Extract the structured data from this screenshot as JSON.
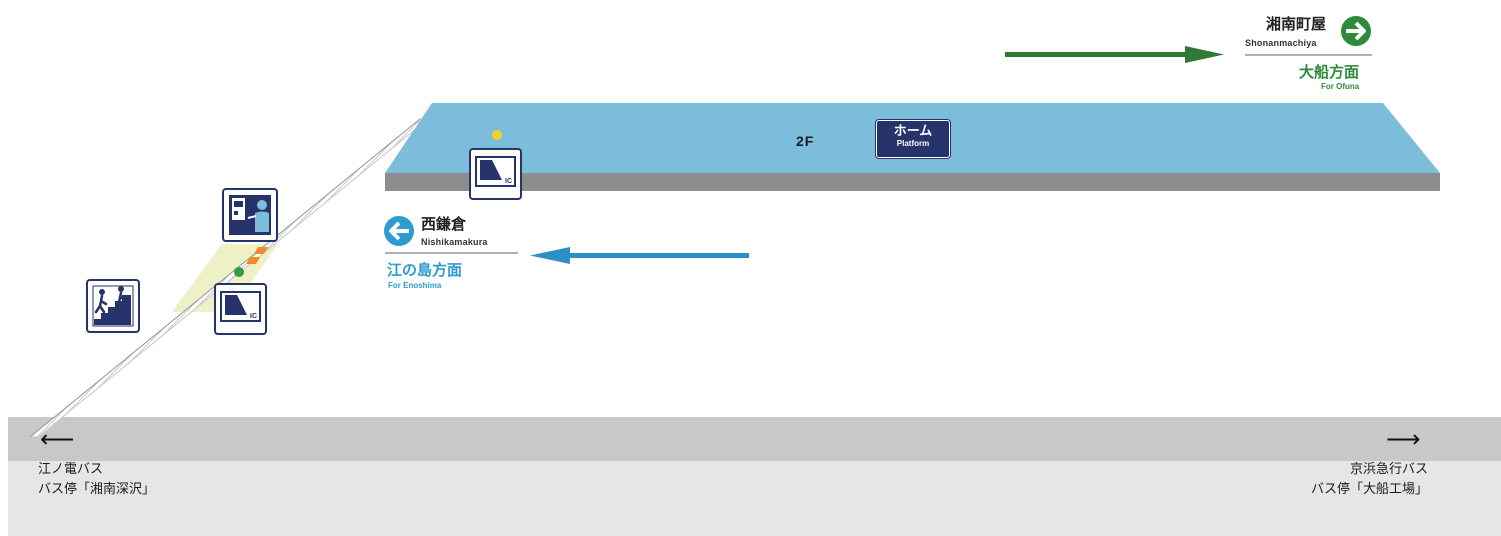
{
  "directions": {
    "right": {
      "station_name": "湘南町屋",
      "station_roman": "Shonanmachiya",
      "direction_jp": "大船方面",
      "direction_en": "For Ofuna",
      "color": "#2f8a3a"
    },
    "left": {
      "station_name": "西鎌倉",
      "station_roman": "Nishikamakura",
      "direction_jp": "江の島方面",
      "direction_en": "For Enoshima",
      "color": "#2e9ad0"
    }
  },
  "platform": {
    "floor": "2F",
    "label_jp": "ホーム",
    "label_en": "Platform",
    "color": "#7dbddc"
  },
  "bus_stops": {
    "left": {
      "line1": "江ノ電バス",
      "line2": "バス停「湘南深沢」",
      "arrow": "⟵"
    },
    "right": {
      "line1": "京浜急行バス",
      "line2": "バス停「大船工場」",
      "arrow": "⟶"
    }
  },
  "icons": {
    "ic_gate_platform": "ic-card-reader-icon",
    "ic_gate_ground": "ic-card-reader-icon",
    "ticket_machine": "ticket-machine-icon",
    "stairs": "stairs-icon",
    "ic_label": "IC"
  }
}
